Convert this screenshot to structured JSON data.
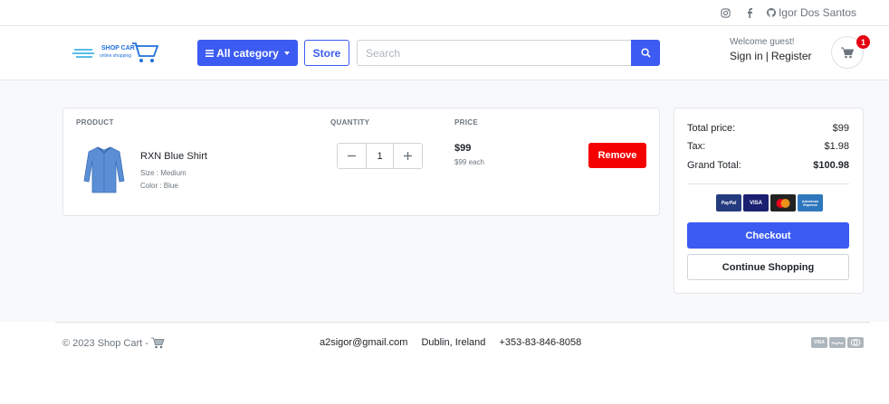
{
  "topbar": {
    "user_name": "Igor Dos Santos",
    "icons": [
      "instagram-icon",
      "facebook-icon",
      "github-icon"
    ]
  },
  "header": {
    "logo_text_main": "SHOP CART",
    "logo_text_sub": "online shopping",
    "category_label": "All category",
    "store_label": "Store",
    "search_placeholder": "Search",
    "welcome": "Welcome guest!",
    "sign_in": "Sign in",
    "register": "Register",
    "cart_count": "1"
  },
  "cart": {
    "headers": {
      "product": "PRODUCT",
      "quantity": "QUANTITY",
      "price": "PRICE"
    },
    "items": [
      {
        "name": "RXN Blue Shirt",
        "size": "Size : Medium",
        "color": "Color : Blue",
        "quantity": "1",
        "price": "$99",
        "each": "$99 each",
        "remove_label": "Remove"
      }
    ]
  },
  "summary": {
    "total_price_label": "Total price:",
    "total_price": "$99",
    "tax_label": "Tax:",
    "tax": "$1.98",
    "grand_total_label": "Grand Total:",
    "grand_total": "$100.98",
    "payment_cards": [
      "PayPal",
      "VISA",
      "MasterCard",
      "American Express"
    ],
    "checkout_label": "Checkout",
    "continue_label": "Continue Shopping"
  },
  "footer": {
    "copyright": "© 2023 Shop Cart -",
    "email": "a2sigor@gmail.com",
    "location": "Dublin, Ireland",
    "phone": "+353-83-846-8058",
    "cards": [
      "VISA",
      "PayPal",
      "MasterCard"
    ]
  },
  "colors": {
    "primary": "#3b5bf2",
    "danger": "#f50000",
    "badge": "#e60012",
    "background": "#f8f9fa"
  }
}
